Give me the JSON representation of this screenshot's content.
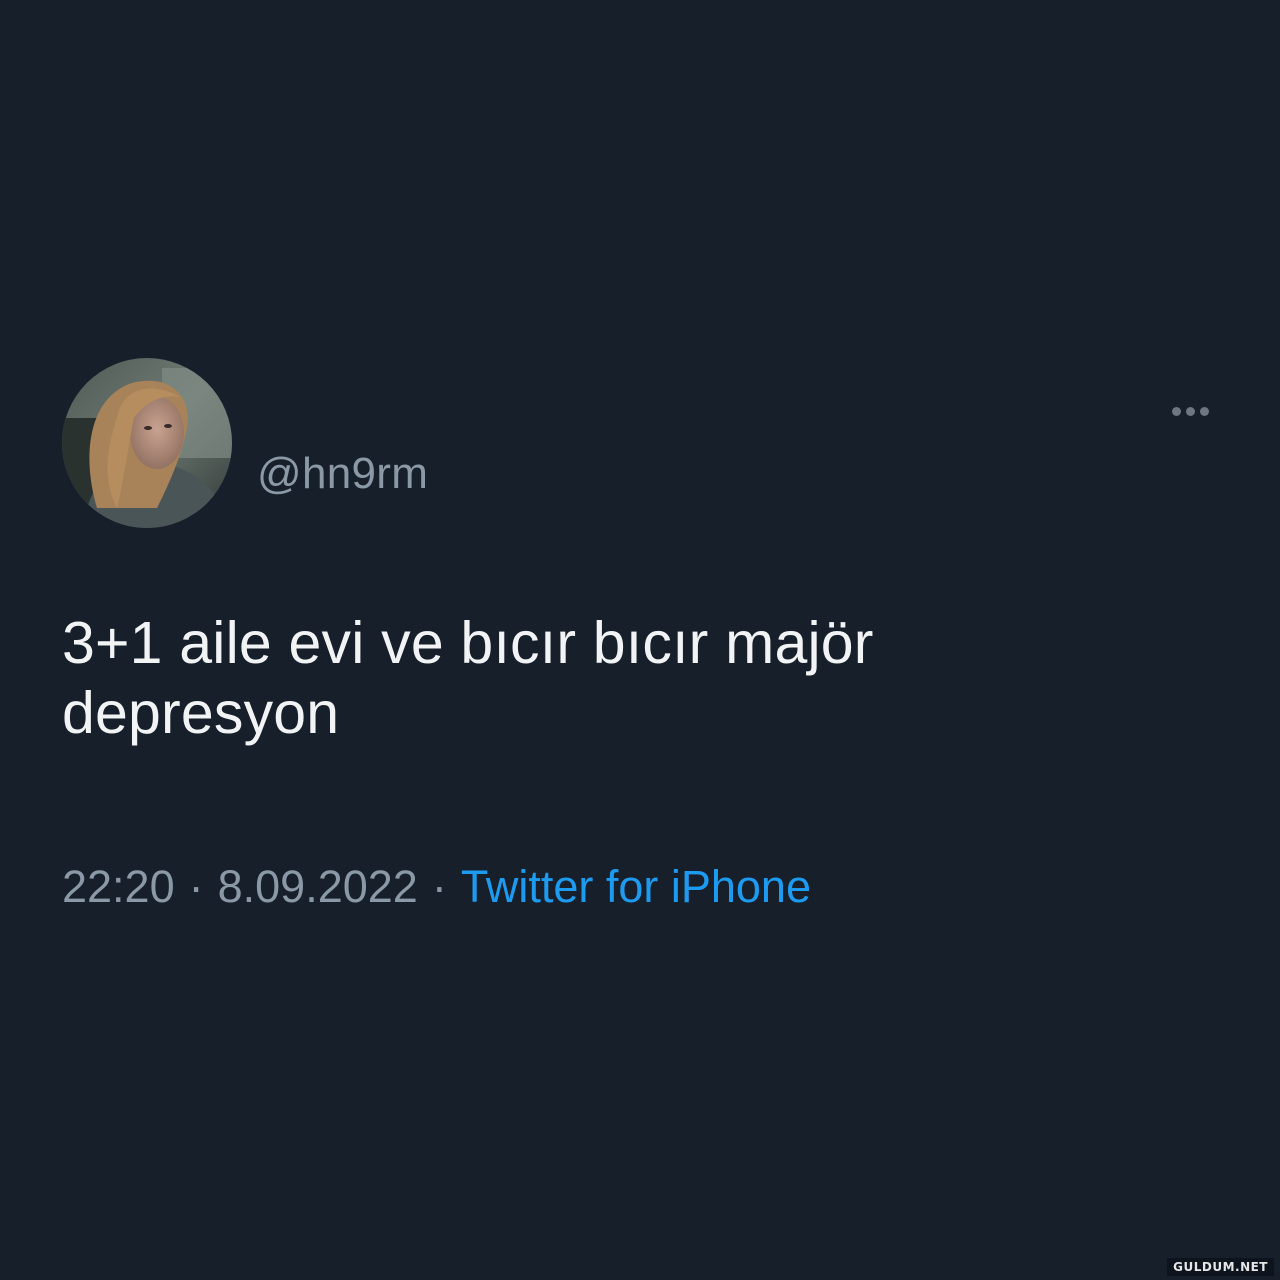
{
  "tweet": {
    "handle": "@hn9rm",
    "text_lines": [
      "3+1 aile evi ve bıcır bıcır majör",
      "depresyon"
    ],
    "time": "22:20",
    "separator": "·",
    "date": "8.09.2022",
    "source": "Twitter for iPhone"
  },
  "icons": {
    "avatar": "profile-photo",
    "more": "more-options-icon"
  },
  "watermark": "GULDUM.NET",
  "colors": {
    "background": "#171f2b",
    "text": "#f1f3f5",
    "muted": "#8b98a5",
    "link": "#1d9bf0"
  }
}
